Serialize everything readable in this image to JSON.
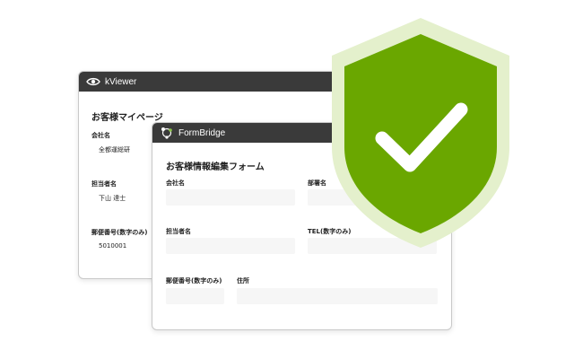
{
  "kviewer": {
    "app_name": "kViewer",
    "page_title": "お客様マイページ",
    "fields": [
      {
        "label": "会社名",
        "value": "全都運総研"
      },
      {
        "label": "担当者名",
        "value": "下山 達士"
      },
      {
        "label": "郵便番号(数字のみ)",
        "value": "5010001"
      }
    ]
  },
  "formbridge": {
    "app_name": "FormBridge",
    "form_title": "お客様情報編集フォーム",
    "fields": {
      "company": "会社名",
      "department": "部署名",
      "person": "担当者名",
      "tel": "TEL(数字のみ)",
      "postal": "郵便番号(数字のみ)",
      "address": "住所"
    }
  },
  "colors": {
    "shield_green": "#6aa700",
    "shield_outline": "#e4f0cc",
    "titlebar": "#3a3a3a"
  },
  "icons": [
    "eye-icon",
    "formbridge-logo-icon",
    "shield-check-icon"
  ]
}
